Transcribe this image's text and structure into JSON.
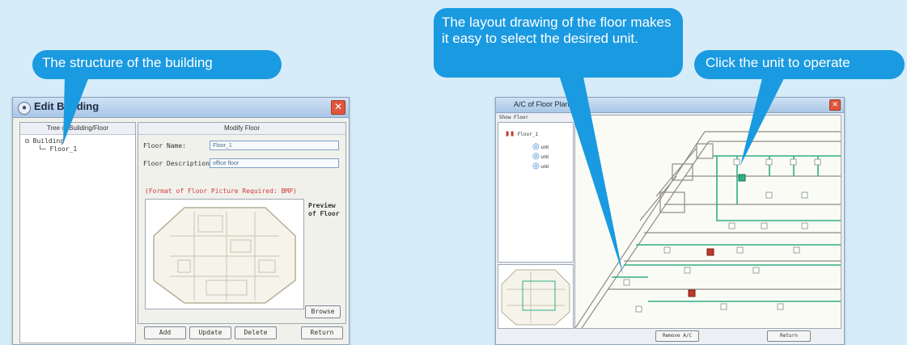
{
  "callouts": {
    "structure": "The structure of the building",
    "layout": "The layout drawing of the floor makes it easy to select the desired unit.",
    "click": "Click the unit to operate"
  },
  "edit_window": {
    "title": "Edit Building",
    "tree_header": "Tree of Building/Floor",
    "tree_items": [
      "Building",
      "Floor_1"
    ],
    "modify_header": "Modify Floor",
    "floor_name_label": "Floor Name:",
    "floor_name_value": "Floor_1",
    "floor_desc_label": "Floor Description:",
    "floor_desc_value": "office floor",
    "format_note": "(Format of Floor Picture Required: BMP)",
    "preview_label": "Preview of Floor",
    "browse_label": "Browse",
    "add_label": "Add",
    "update_label": "Update",
    "delete_label": "Delete",
    "return_label": "Return"
  },
  "floor_window": {
    "title": "A/C of Floor Plan",
    "menu_label": "Show Floor",
    "tree_root": "Floor_1",
    "units": [
      "unit",
      "unit",
      "unit"
    ],
    "btn_left": "Remove A/C",
    "btn_right": "Return"
  },
  "colors": {
    "callout": "#1a9ae0",
    "duct": "#2fae86",
    "unit": "#c0392b"
  }
}
